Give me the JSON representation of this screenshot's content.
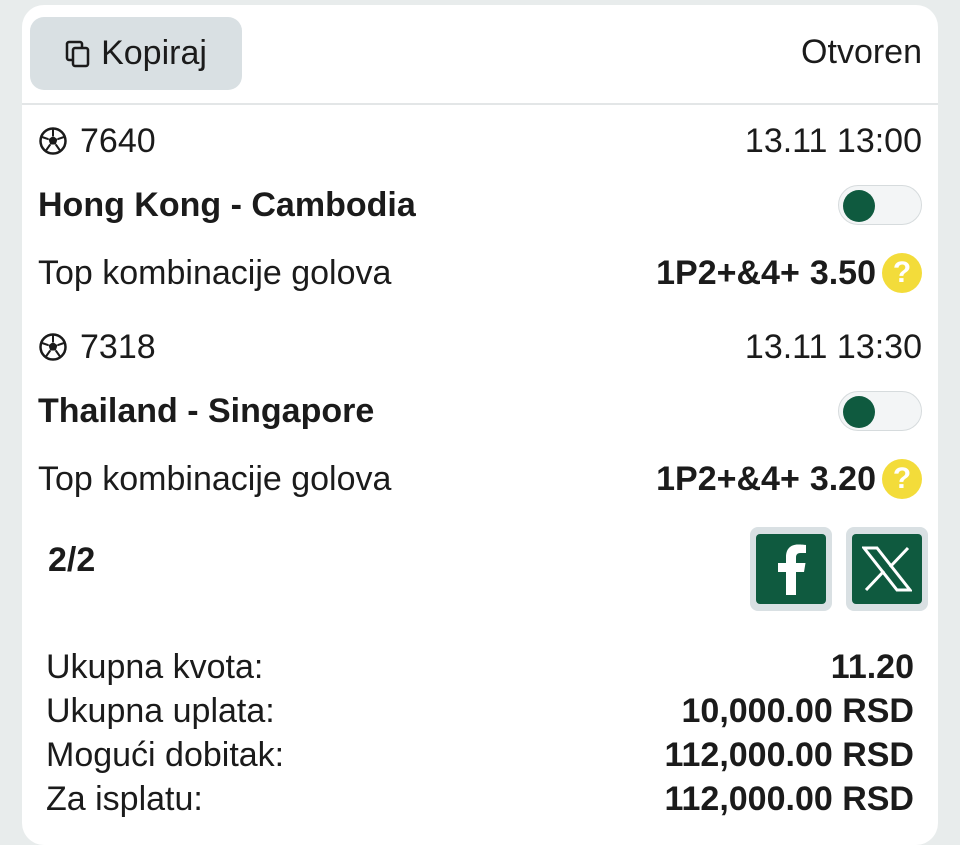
{
  "header": {
    "copy_label": "Kopiraj",
    "status": "Otvoren"
  },
  "matches": [
    {
      "code": "7640",
      "datetime": "13.11 13:00",
      "teams": "Hong Kong - Cambodia",
      "market": "Top kombinacije golova",
      "pick": "1P2+&4+",
      "odds": "3.50",
      "toggle_on": false
    },
    {
      "code": "7318",
      "datetime": "13.11 13:30",
      "teams": "Thailand - Singapore",
      "market": "Top kombinacije golova",
      "pick": "1P2+&4+",
      "odds": "3.20",
      "toggle_on": false
    }
  ],
  "count": "2/2",
  "share": {
    "facebook_icon": "facebook-icon",
    "x_icon": "x-icon"
  },
  "totals": [
    {
      "label": "Ukupna kvota:",
      "value": "11.20"
    },
    {
      "label": "Ukupna uplata:",
      "value": "10,000.00 RSD"
    },
    {
      "label": "Mogući dobitak:",
      "value": "112,000.00 RSD"
    },
    {
      "label": "Za isplatu:",
      "value": "112,000.00 RSD"
    }
  ],
  "colors": {
    "brand_green": "#0f5a3f",
    "help_yellow": "#f3dc3a",
    "button_grey": "#d9e0e3"
  }
}
